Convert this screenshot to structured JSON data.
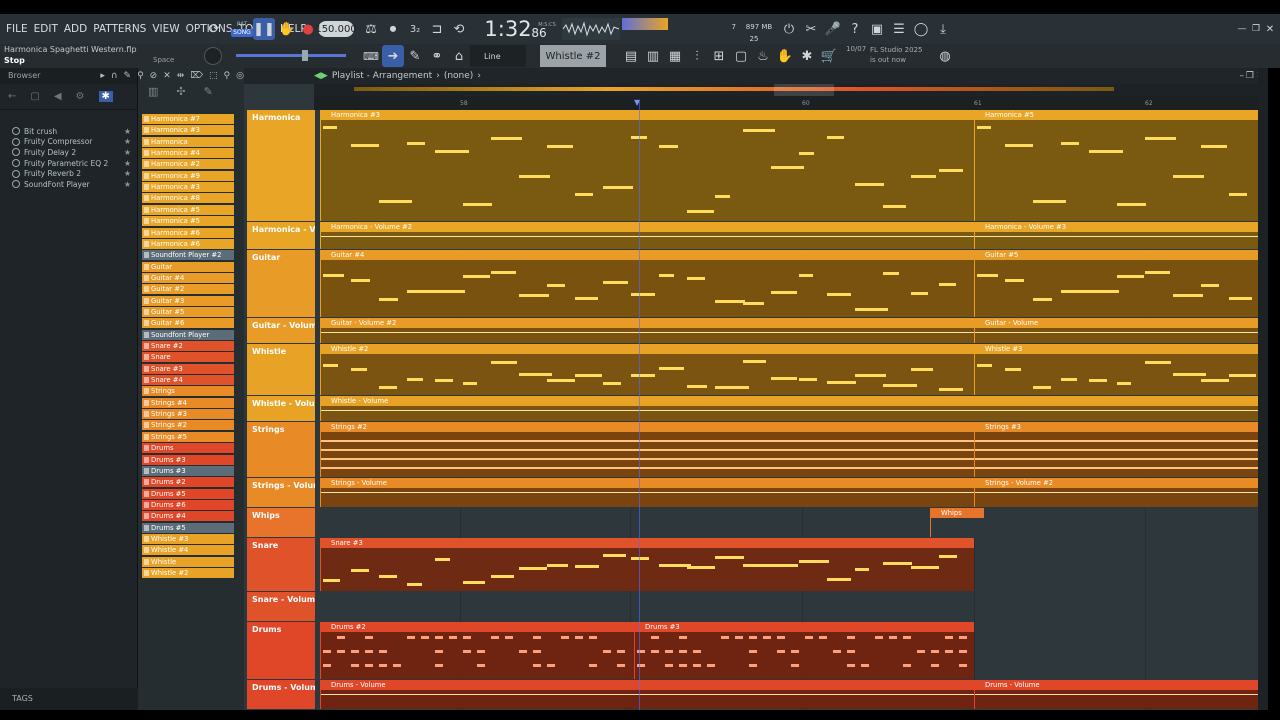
{
  "menu": [
    "FILE",
    "EDIT",
    "ADD",
    "PATTERNS",
    "VIEW",
    "OPTIONS",
    "TOOLS",
    "HELP"
  ],
  "transport": {
    "pattern_label": "PAT",
    "song_label": "SONG",
    "tempo": "150.000",
    "time": "1:32",
    "time_frac": "86",
    "time_unit": "M:S:CS",
    "cpu_num": "7",
    "mem": "897 MB",
    "voices": "25"
  },
  "project": {
    "file": "Harmonica Spaghetti Western.flp",
    "status": "Stop",
    "shortcut": "Space"
  },
  "toolbar2": {
    "snap": "Line",
    "channel": "Whistle #2",
    "news_date": "10/07",
    "news_text": "FL Studio 2025 is out now"
  },
  "browser": {
    "title": "Browser",
    "plugins": [
      "Bit crush",
      "Fruity Compressor",
      "Fruity Delay 2",
      "Fruity Parametric EQ 2",
      "Fruity Reverb 2",
      "SoundFont Player"
    ],
    "tags": "TAGS"
  },
  "patterns": [
    {
      "name": "Harmonica #7",
      "color": "#e8a526"
    },
    {
      "name": "Harmonica #3",
      "color": "#e8a526"
    },
    {
      "name": "Harmonica",
      "color": "#e8a526"
    },
    {
      "name": "Harmonica #4",
      "color": "#e8a526"
    },
    {
      "name": "Harmonica #2",
      "color": "#e8a526"
    },
    {
      "name": "Harmonica #9",
      "color": "#e8a526"
    },
    {
      "name": "Harmonica #3",
      "color": "#e8a526"
    },
    {
      "name": "Harmonica #8",
      "color": "#e8a526"
    },
    {
      "name": "Harmonica #5",
      "color": "#e8a526"
    },
    {
      "name": "Harmonica #5",
      "color": "#e8a526"
    },
    {
      "name": "Harmonica #6",
      "color": "#e8a526"
    },
    {
      "name": "Harmonica #6",
      "color": "#e8a526"
    },
    {
      "name": "Soundfont Player #2",
      "color": "#5b6d78"
    },
    {
      "name": "Guitar",
      "color": "#e89b26"
    },
    {
      "name": "Guitar #4",
      "color": "#e89b26"
    },
    {
      "name": "Guitar #2",
      "color": "#e89b26"
    },
    {
      "name": "Guitar #3",
      "color": "#e89b26"
    },
    {
      "name": "Guitar #5",
      "color": "#e89b26"
    },
    {
      "name": "Guitar #6",
      "color": "#e89b26"
    },
    {
      "name": "Soundfont Player",
      "color": "#5b6d78"
    },
    {
      "name": "Snare #2",
      "color": "#e0532a"
    },
    {
      "name": "Snare",
      "color": "#e0532a"
    },
    {
      "name": "Snare #3",
      "color": "#e0532a"
    },
    {
      "name": "Snare #4",
      "color": "#e0532a"
    },
    {
      "name": "Strings",
      "color": "#e88a26"
    },
    {
      "name": "Strings #4",
      "color": "#e88a26"
    },
    {
      "name": "Strings #3",
      "color": "#e88a26"
    },
    {
      "name": "Strings #2",
      "color": "#e88a26"
    },
    {
      "name": "Strings #5",
      "color": "#e88a26"
    },
    {
      "name": "Drums",
      "color": "#e04628"
    },
    {
      "name": "Drums #3",
      "color": "#e04628"
    },
    {
      "name": "Drums #3",
      "color": "#5b6d78"
    },
    {
      "name": "Drums #2",
      "color": "#e04628"
    },
    {
      "name": "Drums #5",
      "color": "#e04628"
    },
    {
      "name": "Drums #6",
      "color": "#e04628"
    },
    {
      "name": "Drums #4",
      "color": "#e04628"
    },
    {
      "name": "Drums #5",
      "color": "#5b6d78"
    },
    {
      "name": "Whistle #3",
      "color": "#e8a326"
    },
    {
      "name": "Whistle #4",
      "color": "#e8a326"
    },
    {
      "name": "Whistle",
      "color": "#e8a326"
    },
    {
      "name": "Whistle #2",
      "color": "#e8a326"
    }
  ],
  "playlist": {
    "title": "Playlist - Arrangement",
    "arrangement": "(none)",
    "bars": [
      "58",
      "60",
      "61",
      "62"
    ]
  },
  "tracks": [
    {
      "name": "Harmonica",
      "color": "#e8a526",
      "clip_bg": "#7a5a10",
      "clips": [
        "Harmonica #3",
        "Harmonica #5"
      ]
    },
    {
      "name": "Harmonica - Vol...",
      "color": "#e8a526",
      "clip_bg": "#7a5a10",
      "clips": [
        "Harmonica - Volume #2",
        "Harmonica - Volume #3"
      ]
    },
    {
      "name": "Guitar",
      "color": "#e89b26",
      "clip_bg": "#7a5210",
      "clips": [
        "Guitar #4",
        "Guitar #5"
      ]
    },
    {
      "name": "Guitar - Volume",
      "color": "#e89b26",
      "clip_bg": "#7a5210",
      "clips": [
        "Guitar - Volume #2",
        "Guitar - Volume"
      ]
    },
    {
      "name": "Whistle",
      "color": "#e8a326",
      "clip_bg": "#7a5410",
      "clips": [
        "Whistle #2",
        "Whistle #3"
      ]
    },
    {
      "name": "Whistle - Volume",
      "color": "#e8a326",
      "clip_bg": "#7a5410",
      "clips": [
        "Whistle - Volume"
      ]
    },
    {
      "name": "Strings",
      "color": "#e88a26",
      "clip_bg": "#7a4410",
      "clips": [
        "Strings #2",
        "Strings #3"
      ]
    },
    {
      "name": "Strings - Volume",
      "color": "#e88a26",
      "clip_bg": "#7a4410",
      "clips": [
        "Strings - Volume",
        "Strings - Volume #2"
      ]
    },
    {
      "name": "Whips",
      "color": "#e8732a",
      "clip_bg": "#2e373c",
      "clips": [
        "Whips"
      ]
    },
    {
      "name": "Snare",
      "color": "#e0532a",
      "clip_bg": "#6e2a12",
      "clips": [
        "Snare #3"
      ]
    },
    {
      "name": "Snare - Volume",
      "color": "#e0532a",
      "clip_bg": "#2e373c",
      "clips": []
    },
    {
      "name": "Drums",
      "color": "#e04628",
      "clip_bg": "#6e2410",
      "clips": [
        "Drums #2",
        "Drums #3"
      ]
    },
    {
      "name": "Drums - Volume",
      "color": "#e04628",
      "clip_bg": "#6e2410",
      "clips": [
        "Drums - Volume",
        "Drums - Volume"
      ]
    }
  ]
}
